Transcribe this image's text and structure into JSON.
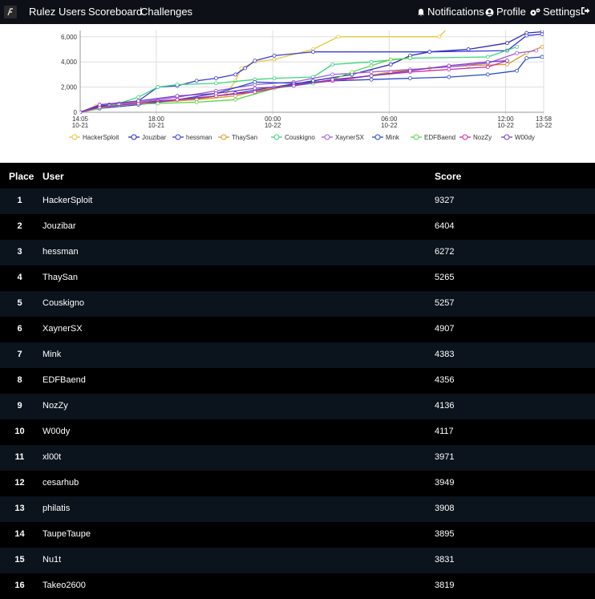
{
  "nav": {
    "left": [
      "Rulez",
      "Users",
      "Scoreboard",
      "Challenges"
    ],
    "right": {
      "notifications": "Notifications",
      "profile": "Profile",
      "settings": "Settings"
    }
  },
  "chart_data": {
    "type": "line",
    "y_ticks": [
      "0",
      "2,000",
      "4,000",
      "6,000"
    ],
    "ylim": [
      0,
      6500
    ],
    "x_ticks": [
      {
        "time": "14:05",
        "date": "10-21"
      },
      {
        "time": "18:00",
        "date": "10-21"
      },
      {
        "time": "00:00",
        "date": "10-22"
      },
      {
        "time": "06:00",
        "date": "10-22"
      },
      {
        "time": "12:00",
        "date": "10-22"
      },
      {
        "time": "13:58",
        "date": "10-22"
      }
    ],
    "x_tick_hours": [
      0,
      3.92,
      9.92,
      15.92,
      21.92,
      23.88
    ],
    "x_range_hours": [
      0,
      23.88
    ],
    "legend_position": "bottom",
    "grid": true,
    "series": [
      {
        "name": "HackerSploit",
        "color": "#e8c53a",
        "points": [
          [
            0,
            0
          ],
          [
            0.8,
            500
          ],
          [
            2,
            600
          ],
          [
            3,
            800
          ],
          [
            4,
            900
          ],
          [
            6,
            1000
          ],
          [
            7.5,
            1400
          ],
          [
            8,
            2500
          ],
          [
            8.3,
            3500
          ],
          [
            9,
            4000
          ],
          [
            10,
            4200
          ],
          [
            12,
            5000
          ],
          [
            13.3,
            6000
          ],
          [
            18.5,
            6000
          ],
          [
            19,
            6800
          ]
        ]
      },
      {
        "name": "Jouzibar",
        "color": "#2a2ab8",
        "points": [
          [
            0,
            0
          ],
          [
            1,
            500
          ],
          [
            3,
            700
          ],
          [
            4,
            900
          ],
          [
            6,
            1100
          ],
          [
            8,
            1500
          ],
          [
            10,
            2000
          ],
          [
            12,
            2500
          ],
          [
            14,
            3000
          ],
          [
            16,
            3800
          ],
          [
            17,
            4500
          ],
          [
            18,
            4800
          ],
          [
            20,
            5000
          ],
          [
            22,
            5500
          ],
          [
            23,
            6300
          ],
          [
            23.8,
            6400
          ]
        ]
      },
      {
        "name": "hessman",
        "color": "#3a3ad6",
        "points": [
          [
            0,
            0
          ],
          [
            1.5,
            600
          ],
          [
            3,
            900
          ],
          [
            4,
            2000
          ],
          [
            5,
            2100
          ],
          [
            6,
            2500
          ],
          [
            7,
            2700
          ],
          [
            8,
            3000
          ],
          [
            8.5,
            3500
          ],
          [
            9,
            4100
          ],
          [
            10,
            4500
          ],
          [
            12,
            4800
          ],
          [
            18,
            4800
          ],
          [
            22,
            4900
          ],
          [
            23,
            6100
          ],
          [
            23.8,
            6200
          ]
        ]
      },
      {
        "name": "ThaySan",
        "color": "#d69a2a",
        "points": [
          [
            0,
            0
          ],
          [
            2,
            700
          ],
          [
            4,
            800
          ],
          [
            6,
            1000
          ],
          [
            8,
            1300
          ],
          [
            10,
            2000
          ],
          [
            12,
            2300
          ],
          [
            14,
            2700
          ],
          [
            16,
            3200
          ],
          [
            18,
            3500
          ],
          [
            20,
            3700
          ],
          [
            22,
            3800
          ],
          [
            23,
            4700
          ],
          [
            23.8,
            5200
          ]
        ]
      },
      {
        "name": "Couskigno",
        "color": "#3ad67a",
        "points": [
          [
            0,
            0
          ],
          [
            1,
            300
          ],
          [
            2,
            700
          ],
          [
            3,
            1200
          ],
          [
            4,
            2000
          ],
          [
            5,
            2200
          ],
          [
            7,
            2300
          ],
          [
            9,
            2600
          ],
          [
            10,
            2700
          ],
          [
            12,
            2800
          ],
          [
            13,
            3800
          ],
          [
            15,
            4000
          ],
          [
            17,
            4300
          ],
          [
            21,
            4400
          ],
          [
            22.5,
            5200
          ]
        ]
      },
      {
        "name": "XaynerSX",
        "color": "#a45ad6",
        "points": [
          [
            0,
            0
          ],
          [
            1,
            600
          ],
          [
            3,
            800
          ],
          [
            5,
            1200
          ],
          [
            7,
            1700
          ],
          [
            9,
            2200
          ],
          [
            11,
            2400
          ],
          [
            13,
            3000
          ],
          [
            15,
            3200
          ],
          [
            17,
            3400
          ],
          [
            19,
            3600
          ],
          [
            21,
            3900
          ],
          [
            22.5,
            4700
          ],
          [
            23.5,
            4900
          ]
        ]
      },
      {
        "name": "Mink",
        "color": "#2a4ac6",
        "points": [
          [
            0,
            0
          ],
          [
            1,
            300
          ],
          [
            3,
            600
          ],
          [
            5,
            1000
          ],
          [
            7,
            1500
          ],
          [
            9,
            2400
          ],
          [
            11,
            2300
          ],
          [
            13,
            2500
          ],
          [
            15,
            2600
          ],
          [
            17,
            2700
          ],
          [
            19,
            2800
          ],
          [
            21,
            3000
          ],
          [
            22.5,
            3300
          ],
          [
            23,
            4300
          ],
          [
            23.8,
            4400
          ]
        ]
      },
      {
        "name": "EDFBaend",
        "color": "#5ad64a",
        "points": [
          [
            0,
            0
          ],
          [
            2,
            600
          ],
          [
            4,
            700
          ],
          [
            6,
            800
          ],
          [
            8,
            1000
          ],
          [
            10,
            1900
          ],
          [
            12,
            2300
          ],
          [
            13,
            2600
          ],
          [
            14,
            3200
          ],
          [
            15,
            3700
          ],
          [
            16,
            4200
          ],
          [
            17,
            4300
          ]
        ]
      },
      {
        "name": "NozZy",
        "color": "#c62aa4",
        "points": [
          [
            0,
            0
          ],
          [
            1,
            400
          ],
          [
            3,
            700
          ],
          [
            5,
            1000
          ],
          [
            7,
            1300
          ],
          [
            9,
            1600
          ],
          [
            11,
            2200
          ],
          [
            13,
            2500
          ],
          [
            15,
            2900
          ],
          [
            17,
            3200
          ],
          [
            19,
            3400
          ],
          [
            21,
            3600
          ],
          [
            22,
            4100
          ]
        ]
      },
      {
        "name": "W00dy",
        "color": "#7a3ac6",
        "points": [
          [
            0,
            0
          ],
          [
            1,
            600
          ],
          [
            3,
            900
          ],
          [
            5,
            1300
          ],
          [
            7,
            1500
          ],
          [
            9,
            1900
          ],
          [
            11,
            2100
          ],
          [
            13,
            2600
          ],
          [
            15,
            2900
          ],
          [
            17,
            3300
          ],
          [
            19,
            3700
          ],
          [
            21,
            4000
          ],
          [
            22,
            4100
          ]
        ]
      }
    ]
  },
  "scoreboard": {
    "headers": {
      "place": "Place",
      "user": "User",
      "score": "Score"
    },
    "rows": [
      {
        "place": "1",
        "user": "HackerSploit",
        "score": "9327"
      },
      {
        "place": "2",
        "user": "Jouzibar",
        "score": "6404"
      },
      {
        "place": "3",
        "user": "hessman",
        "score": "6272"
      },
      {
        "place": "4",
        "user": "ThaySan",
        "score": "5265"
      },
      {
        "place": "5",
        "user": "Couskigno",
        "score": "5257"
      },
      {
        "place": "6",
        "user": "XaynerSX",
        "score": "4907"
      },
      {
        "place": "7",
        "user": "Mink",
        "score": "4383"
      },
      {
        "place": "8",
        "user": "EDFBaend",
        "score": "4356"
      },
      {
        "place": "9",
        "user": "NozZy",
        "score": "4136"
      },
      {
        "place": "10",
        "user": "W00dy",
        "score": "4117"
      },
      {
        "place": "11",
        "user": "xl00t",
        "score": "3971"
      },
      {
        "place": "12",
        "user": "cesarhub",
        "score": "3949"
      },
      {
        "place": "13",
        "user": "philatis",
        "score": "3908"
      },
      {
        "place": "14",
        "user": "TaupeTaupe",
        "score": "3895"
      },
      {
        "place": "15",
        "user": "Nu1t",
        "score": "3831"
      },
      {
        "place": "16",
        "user": "Takeo2600",
        "score": "3819"
      }
    ]
  }
}
